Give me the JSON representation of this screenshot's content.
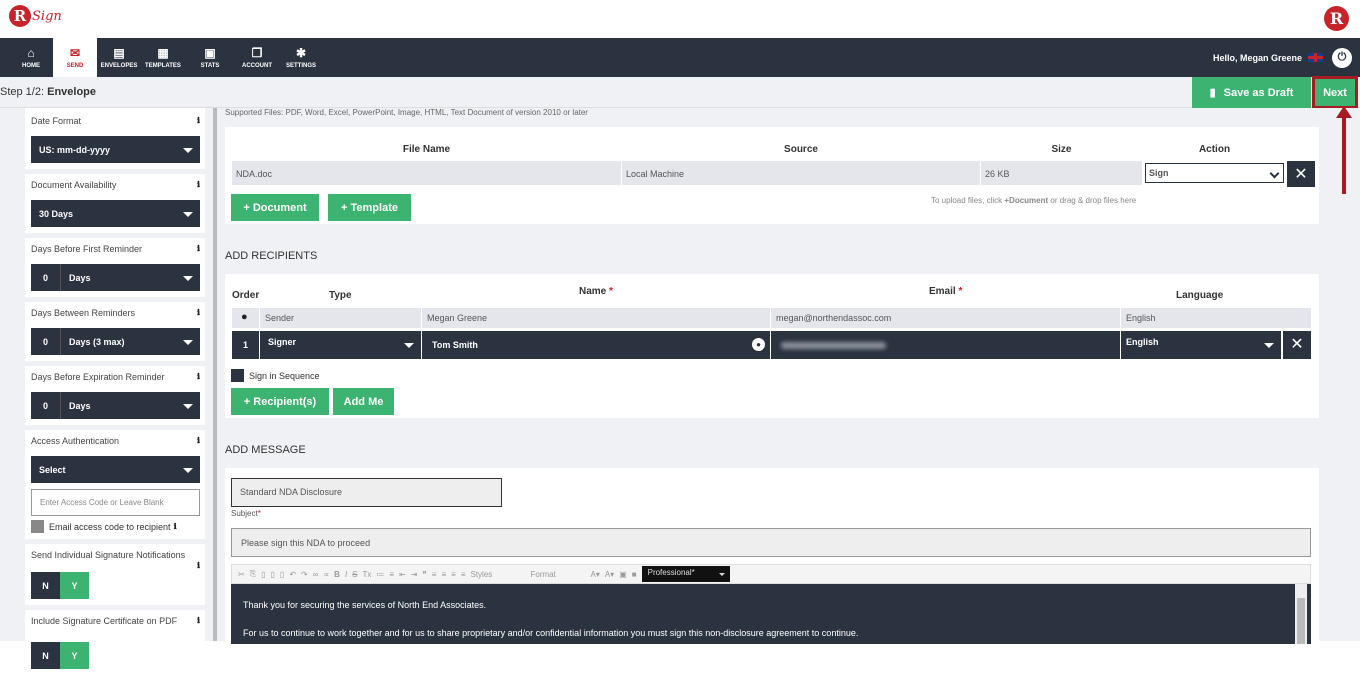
{
  "app": {
    "logo_text": "Sign",
    "logo_letter": "R"
  },
  "nav": {
    "items": [
      {
        "label": "HOME",
        "icon": "home-icon"
      },
      {
        "label": "SEND",
        "icon": "envelope-icon"
      },
      {
        "label": "ENVELOPES",
        "icon": "envelopes-icon"
      },
      {
        "label": "TEMPLATES",
        "icon": "templates-icon"
      },
      {
        "label": "STATS",
        "icon": "briefcase-icon"
      },
      {
        "label": "ACCOUNT",
        "icon": "account-icon"
      },
      {
        "label": "SETTINGS",
        "icon": "gear-icon"
      }
    ],
    "greeting": "Hello, Megan Greene"
  },
  "step": {
    "prefix": "Step 1/2:",
    "title": "Envelope",
    "save_draft": "Save as Draft",
    "next": "Next"
  },
  "sidebar": {
    "date_format": {
      "label": "Date Format",
      "value": "US: mm-dd-yyyy"
    },
    "availability": {
      "label": "Document Availability",
      "value": "30 Days"
    },
    "first_reminder": {
      "label": "Days Before First Reminder",
      "num": "0",
      "value": "Days"
    },
    "between_reminders": {
      "label": "Days Between Reminders",
      "num": "0",
      "value": "Days (3 max)"
    },
    "expiration": {
      "label": "Days Before Expiration Reminder",
      "num": "0",
      "value": "Days"
    },
    "access": {
      "label": "Access Authentication",
      "value": "Select",
      "placeholder": "Enter Access Code or Leave Blank",
      "email_code": "Email access code to recipient"
    },
    "individual": {
      "label": "Send Individual Signature Notifications",
      "n": "N",
      "y": "Y"
    },
    "certificate": {
      "label": "Include Signature Certificate on PDF",
      "n": "N",
      "y": "Y"
    }
  },
  "files": {
    "supported": "Supported Files: PDF, Word, Excel, PowerPoint, Image, HTML, Text Document of version 2010 or later",
    "headers": [
      "File Name",
      "Source",
      "Size",
      "Action"
    ],
    "row": {
      "name": "NDA.doc",
      "source": "Local Machine",
      "size": "26 KB",
      "action": "Sign"
    },
    "add_document": "+ Document",
    "add_template": "+ Template",
    "hint_prefix": "To upload files, click ",
    "hint_bold": "+Document",
    "hint_suffix": " or drag & drop files here"
  },
  "recipients": {
    "heading": "ADD RECIPIENTS",
    "headers": {
      "order": "Order",
      "type": "Type",
      "name": "Name",
      "email": "Email",
      "language": "Language",
      "required": "*"
    },
    "sender": {
      "type": "Sender",
      "name": "Megan Greene",
      "email": "megan@northendassoc.com",
      "language": "English"
    },
    "signer": {
      "order": "1",
      "type": "Signer",
      "name": "Tom Smith",
      "language": "English"
    },
    "sequence": "Sign in Sequence",
    "add_recipient": "+ Recipient(s)",
    "add_me": "Add Me"
  },
  "message": {
    "heading": "ADD MESSAGE",
    "template": "Standard NDA Disclosure",
    "subject_label": "Subject",
    "subject_value": "Please sign this NDA to proceed",
    "toolbar": {
      "styles": "Styles",
      "format": "Format",
      "theme": "Professional*"
    },
    "body_line1": "Thank you for securing the services of North End Associates.",
    "body_line2": "For us to continue to work together and for us to share proprietary and/or confidential information you must sign this non-disclosure agreement to continue."
  }
}
